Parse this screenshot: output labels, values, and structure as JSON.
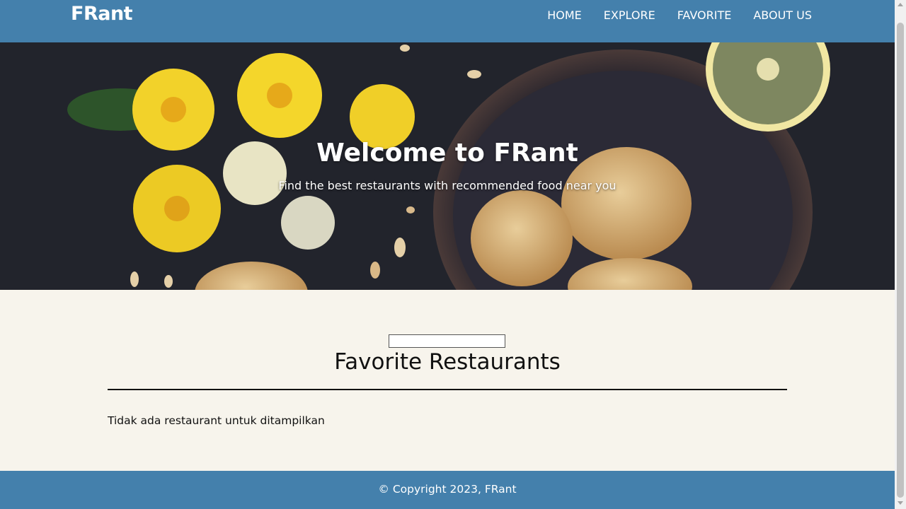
{
  "header": {
    "brand": "FRant",
    "nav": [
      "HOME",
      "EXPLORE",
      "FAVORITE",
      "ABOUT US"
    ]
  },
  "hero": {
    "title": "Welcome to FRant",
    "subtitle": "Find the best restaurants with recommended food near you"
  },
  "favorites": {
    "search_value": "",
    "title": "Favorite Restaurants",
    "empty_message": "Tidak ada restaurant untuk ditampilkan"
  },
  "footer": {
    "copyright": "© Copyright 2023, FRant"
  },
  "colors": {
    "header_bg": "#4480ac",
    "page_bg": "#f7f4ec"
  }
}
